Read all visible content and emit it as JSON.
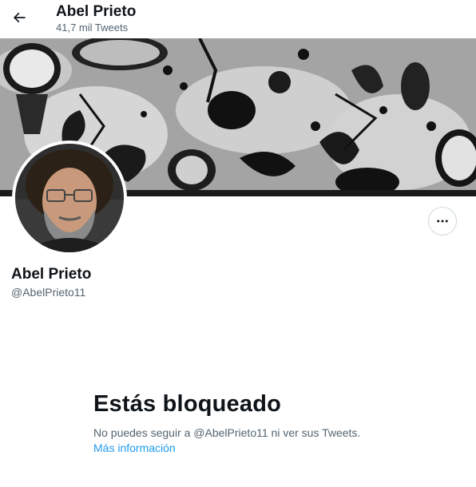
{
  "header": {
    "title": "Abel Prieto",
    "subtitle": "41,7 mil Tweets",
    "back_icon": "arrow-left-icon"
  },
  "profile": {
    "name": "Abel Prieto",
    "handle": "@AbelPrieto11",
    "more_icon": "more-horizontal-icon"
  },
  "blocked": {
    "title": "Estás bloqueado",
    "text": "No puedes seguir a @AbelPrieto11 ni ver sus Tweets.",
    "link": "Más información"
  },
  "colors": {
    "link": "#1d9bf0",
    "secondary_text": "#536471",
    "primary_text": "#0f1419"
  }
}
